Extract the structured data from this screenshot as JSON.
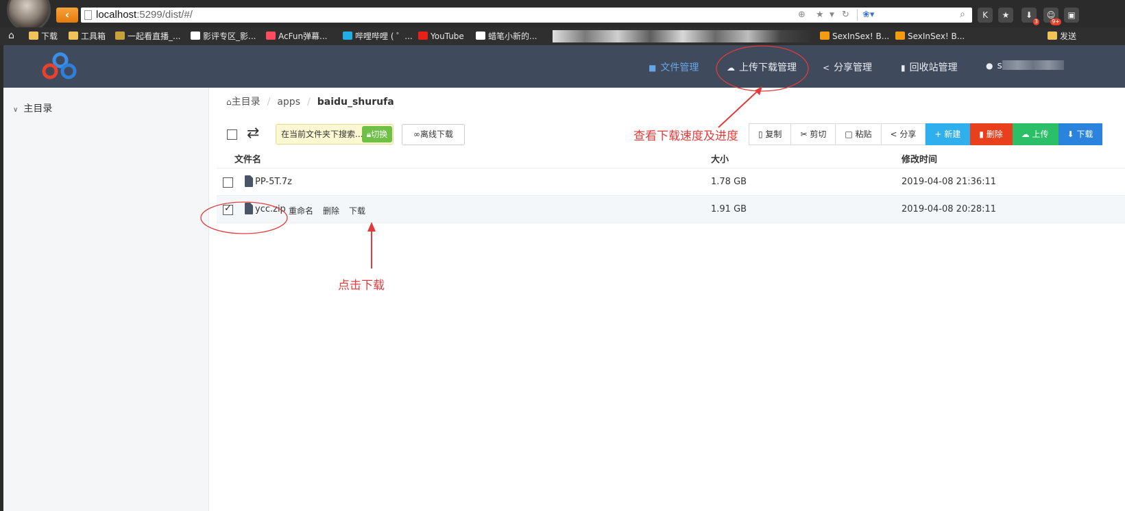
{
  "browser": {
    "url_host": "localhost",
    "url_rest": ":5299/dist/#/",
    "extension_badges": [
      "3",
      "9+"
    ],
    "bookmarks": [
      "下载",
      "工具箱",
      "一起看直播_...",
      "影评专区_影...",
      "AcFun弹幕...",
      "哔哩哔哩 ( ゜...",
      "YouTube",
      "蜡笔小新的...",
      "SexInSex! B...",
      "SexInSex! B...",
      "发送"
    ]
  },
  "header": {
    "nav": [
      {
        "label": "文件管理",
        "icon": "folder-icon",
        "active": true
      },
      {
        "label": "上传下载管理",
        "icon": "cloud-icon",
        "active": false
      },
      {
        "label": "分享管理",
        "icon": "share-icon",
        "active": false
      },
      {
        "label": "回收站管理",
        "icon": "trash-icon",
        "active": false
      }
    ],
    "user_initial": "s"
  },
  "sidebar": {
    "root_label": "主目录"
  },
  "breadcrumb": {
    "home": "主目录",
    "items": [
      "apps",
      "baidu_shurufa"
    ]
  },
  "toolbar": {
    "search_placeholder": "在当前文件夹下搜索...",
    "switch_label": "切换",
    "offline_label": "离线下载",
    "actions": [
      "复制",
      "剪切",
      "粘贴",
      "分享",
      "+ 新建",
      "删除",
      "上传",
      "下载"
    ]
  },
  "table": {
    "headers": {
      "name": "文件名",
      "size": "大小",
      "modified": "修改时间"
    },
    "rows": [
      {
        "name": "PP-5T.7z",
        "size": "1.78 GB",
        "modified": "2019-04-08 21:36:11",
        "checked": false
      },
      {
        "name": "ycc.zip",
        "size": "1.91 GB",
        "modified": "2019-04-08 20:28:11",
        "checked": true,
        "actions": [
          "重命名",
          "删除",
          "下载"
        ]
      }
    ]
  },
  "annotations": {
    "speed_note": "查看下载速度及进度",
    "click_note": "点击下载",
    "color": "#e33b3b"
  }
}
